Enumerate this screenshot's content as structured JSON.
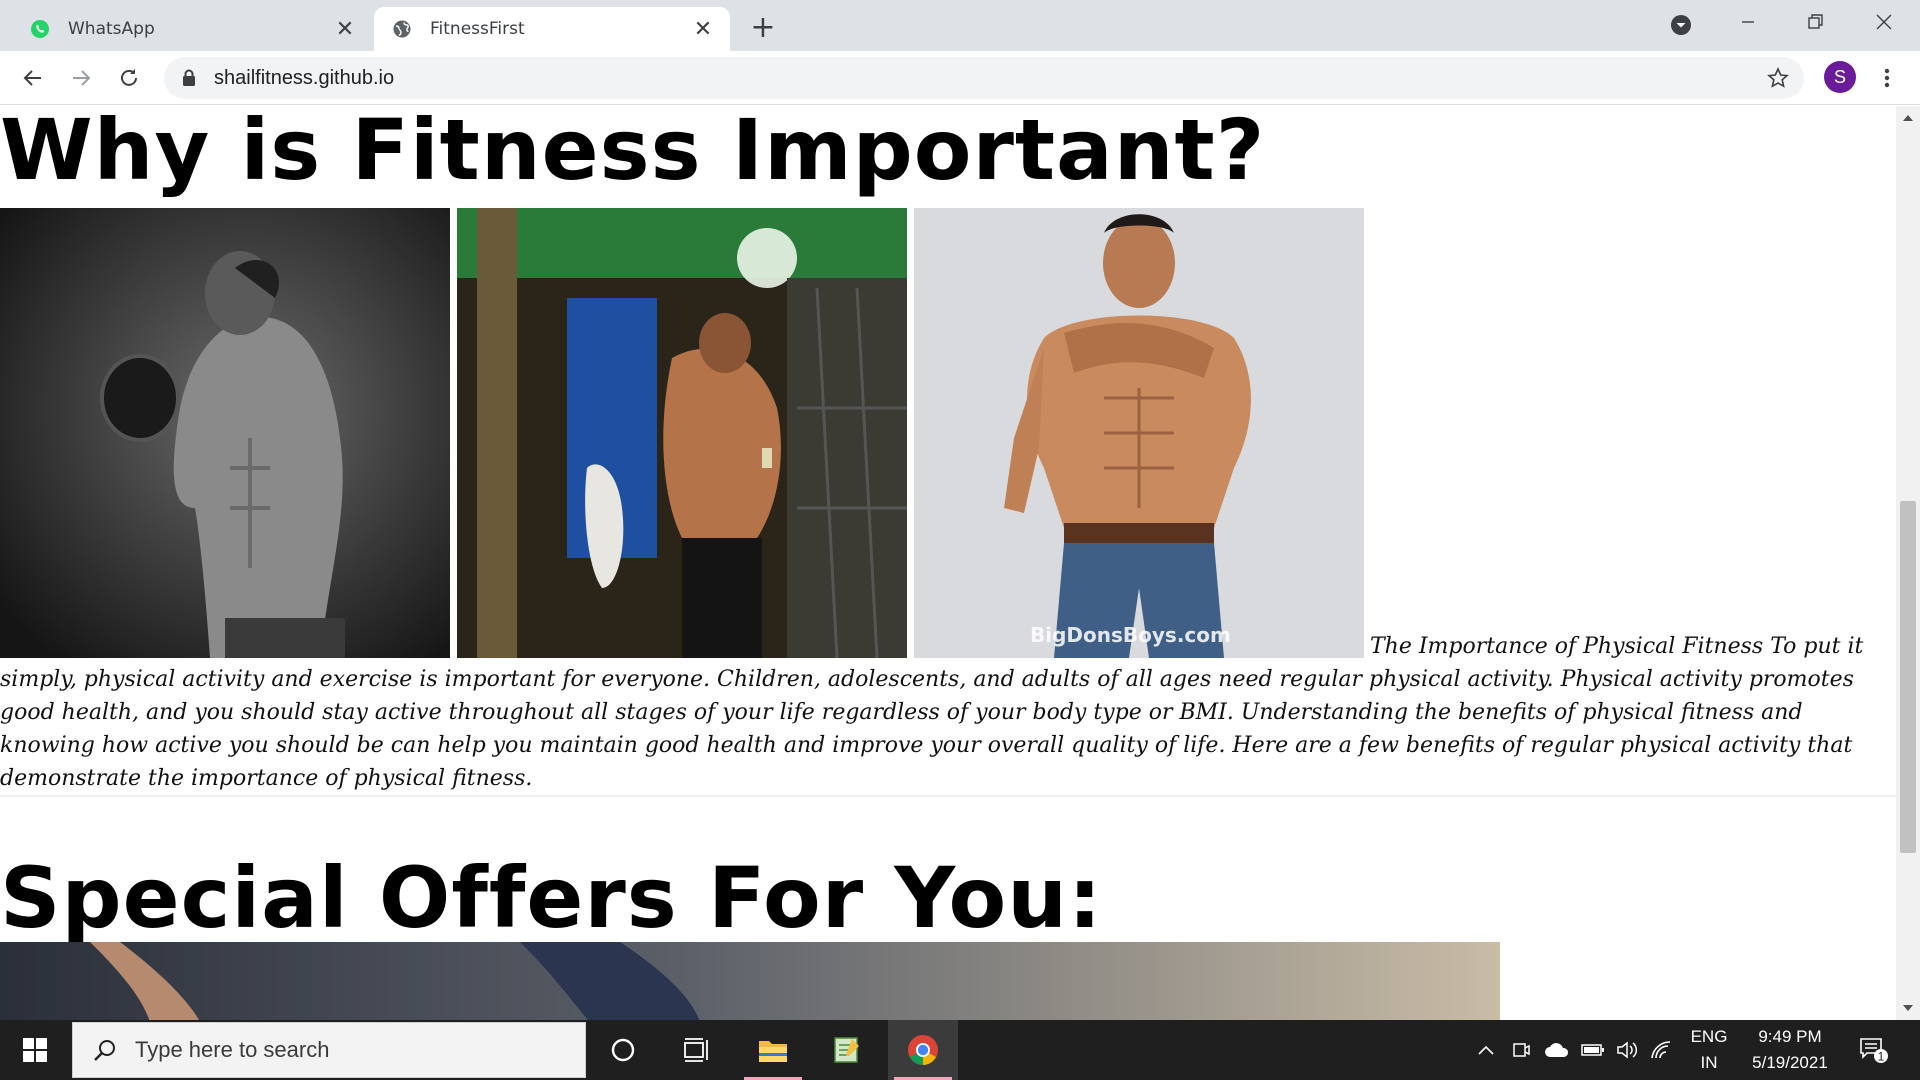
{
  "browser": {
    "tabs": [
      {
        "title": "WhatsApp",
        "icon": "whatsapp-icon",
        "active": false
      },
      {
        "title": "FitnessFirst",
        "icon": "globe-icon",
        "active": true
      }
    ],
    "url": "shailfitness.github.io",
    "profile_initial": "S"
  },
  "page": {
    "heading1": "Why is Fitness Important?",
    "images": [
      {
        "name": "dumbbell-curl-photo",
        "caption": ""
      },
      {
        "name": "mirror-selfie-photo",
        "caption": ""
      },
      {
        "name": "jeans-model-photo",
        "caption": "BigDonsBoys.com"
      }
    ],
    "paragraph": "The Importance of Physical Fitness To put it simply, physical activity and exercise is important for everyone. Children, adolescents, and adults of all ages need regular physical activity. Physical activity promotes good health, and you should stay active throughout all stages of your life regardless of your body type or BMI. Understanding the benefits of physical fitness and knowing how active you should be can help you maintain good health and improve your overall quality of life. Here are a few benefits of regular physical activity that demonstrate the importance of physical fitness.",
    "heading2": "Special Offers For You:"
  },
  "taskbar": {
    "search_placeholder": "Type here to search",
    "language": "ENG",
    "region": "IN",
    "time": "9:49 PM",
    "date": "5/19/2021",
    "notification_count": "1"
  },
  "colors": {
    "tabstrip": "#dee1e6",
    "taskbar": "#1f1f1f",
    "avatar": "#6a1b9a",
    "whatsapp": "#25d366"
  }
}
